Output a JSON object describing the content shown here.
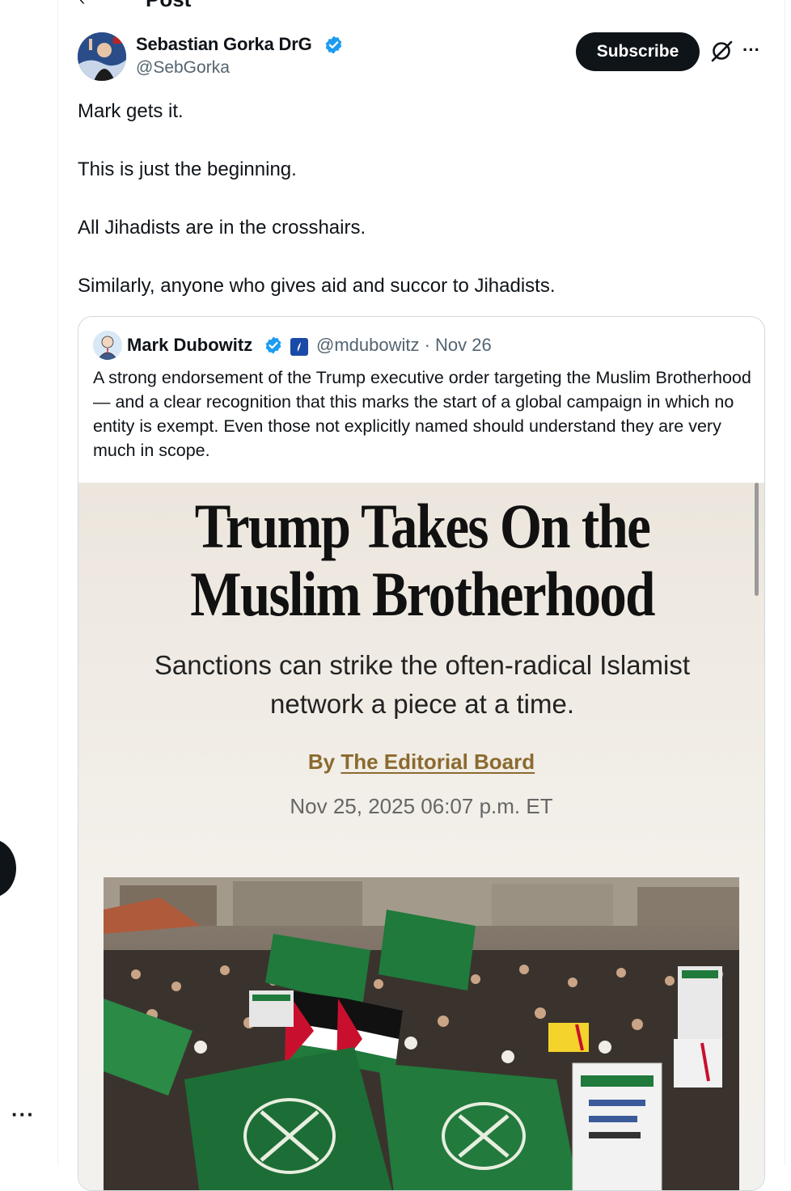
{
  "header": {
    "title": "Post"
  },
  "post": {
    "author_name": "Sebastian Gorka DrG",
    "author_handle": "@SebGorka",
    "subscribe_label": "Subscribe",
    "paragraphs": [
      "Mark gets it.",
      "This is just the beginning.",
      "All Jihadists are in the crosshairs.",
      "Similarly, anyone who gives aid and succor to Jihadists."
    ]
  },
  "quote": {
    "author_name": "Mark Dubowitz",
    "handle_date": "@mdubowitz · Nov 26",
    "text": "A strong endorsement of the Trump executive order targeting the Muslim Brotherhood — and a clear recognition that this marks the start of a global campaign in which no entity is exempt. Even those not explicitly named should understand they are very much in scope.",
    "article": {
      "headline": "Trump Takes On the Muslim Brotherhood",
      "dek": "Sanctions can strike the often-radical Islamist network a piece at a time.",
      "byline_prefix": "By",
      "byline_author": "The Editorial Board",
      "date": "Nov 25, 2025 06:07 p.m. ET"
    }
  },
  "colors": {
    "verified": "#1d9bf0",
    "text": "#0f1419",
    "secondary": "#536471",
    "byline": "#8b6a2f",
    "flag_green": "#1f7a3c"
  },
  "icons": [
    "back-arrow-icon",
    "verified-badge-icon",
    "grok-icon",
    "more-icon",
    "affiliation-badge-icon"
  ]
}
